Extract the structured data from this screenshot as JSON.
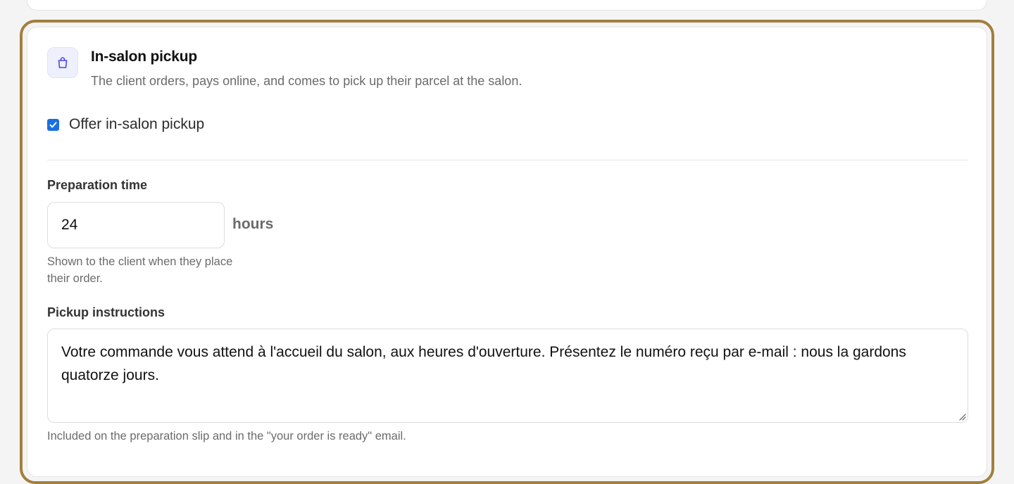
{
  "section": {
    "title": "In-salon pickup",
    "subtitle": "The client orders, pays online, and comes to pick up their parcel at the salon.",
    "icon": "shopping-bag-icon"
  },
  "offer_pickup": {
    "label": "Offer in-salon pickup",
    "checked": true
  },
  "preparation_time": {
    "label": "Preparation time",
    "value": "24",
    "unit": "hours",
    "help_line1": "Shown to the client when they place",
    "help_line2": "their order."
  },
  "pickup_instructions": {
    "label": "Pickup instructions",
    "value": "Votre commande vous attend à l'accueil du salon, aux heures d'ouverture. Présentez le numéro reçu par e-mail : nous la gardons quatorze jours.",
    "help": "Included on the preparation slip and in the \"your order is ready\" email."
  },
  "colors": {
    "accent_outline": "#a37f3c",
    "checkbox": "#1a6fe0",
    "icon_tile": "#eef0fe",
    "icon_stroke": "#4f46e5"
  }
}
